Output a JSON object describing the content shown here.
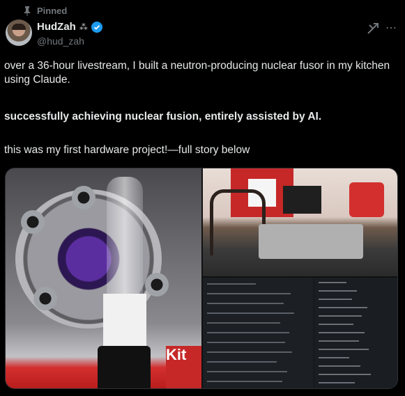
{
  "pinned_label": "Pinned",
  "author": {
    "display_name": "HudZah",
    "name_emoji": "⁂",
    "handle": "@hud_zah",
    "verified": true,
    "verified_color": "#1d9bf0"
  },
  "tweet": {
    "line1": "over a 36-hour livestream, I built a neutron-producing nuclear fusor in my kitchen using Claude.",
    "line2": "successfully achieving nuclear fusion, entirely assisted by AI.",
    "line3": "this was my first hardware project!—full story below"
  },
  "media": {
    "left_photo_label": "Kit",
    "icons": [
      "grok-icon",
      "more-icon"
    ]
  },
  "colors": {
    "background": "#000000",
    "text": "#e7e9ea",
    "muted": "#71767b",
    "accent": "#1d9bf0"
  }
}
